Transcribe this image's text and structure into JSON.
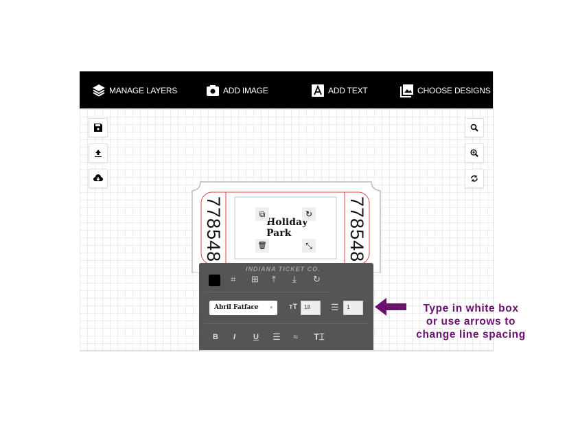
{
  "toolbar": {
    "items": [
      {
        "label": "MANAGE LAYERS",
        "icon": "layers-icon"
      },
      {
        "label": "ADD IMAGE",
        "icon": "camera-icon"
      },
      {
        "label": "ADD TEXT",
        "icon": "text-a-icon"
      },
      {
        "label": "CHOOSE DESIGNS",
        "icon": "image-gallery-icon"
      }
    ]
  },
  "left_tools": [
    "save-icon",
    "upload-icon",
    "cloud-download-icon"
  ],
  "right_tools": [
    "search-icon",
    "zoom-in-icon",
    "refresh-icon"
  ],
  "ticket": {
    "number_left": "778548",
    "number_right": "778548",
    "text_line1": "Holiday",
    "text_line2": "Park",
    "printer": "INDIANA TICKET CO.",
    "border_color": "#e04040"
  },
  "panel": {
    "color": "#000000",
    "font": "Abril Fatface",
    "font_size": "18",
    "line_spacing": "1",
    "format": [
      "B",
      "I",
      "U"
    ]
  },
  "annotation": {
    "line1": "Type in white box",
    "line2": "or use arrows to",
    "line3": "change line spacing",
    "color": "#6b1170"
  }
}
